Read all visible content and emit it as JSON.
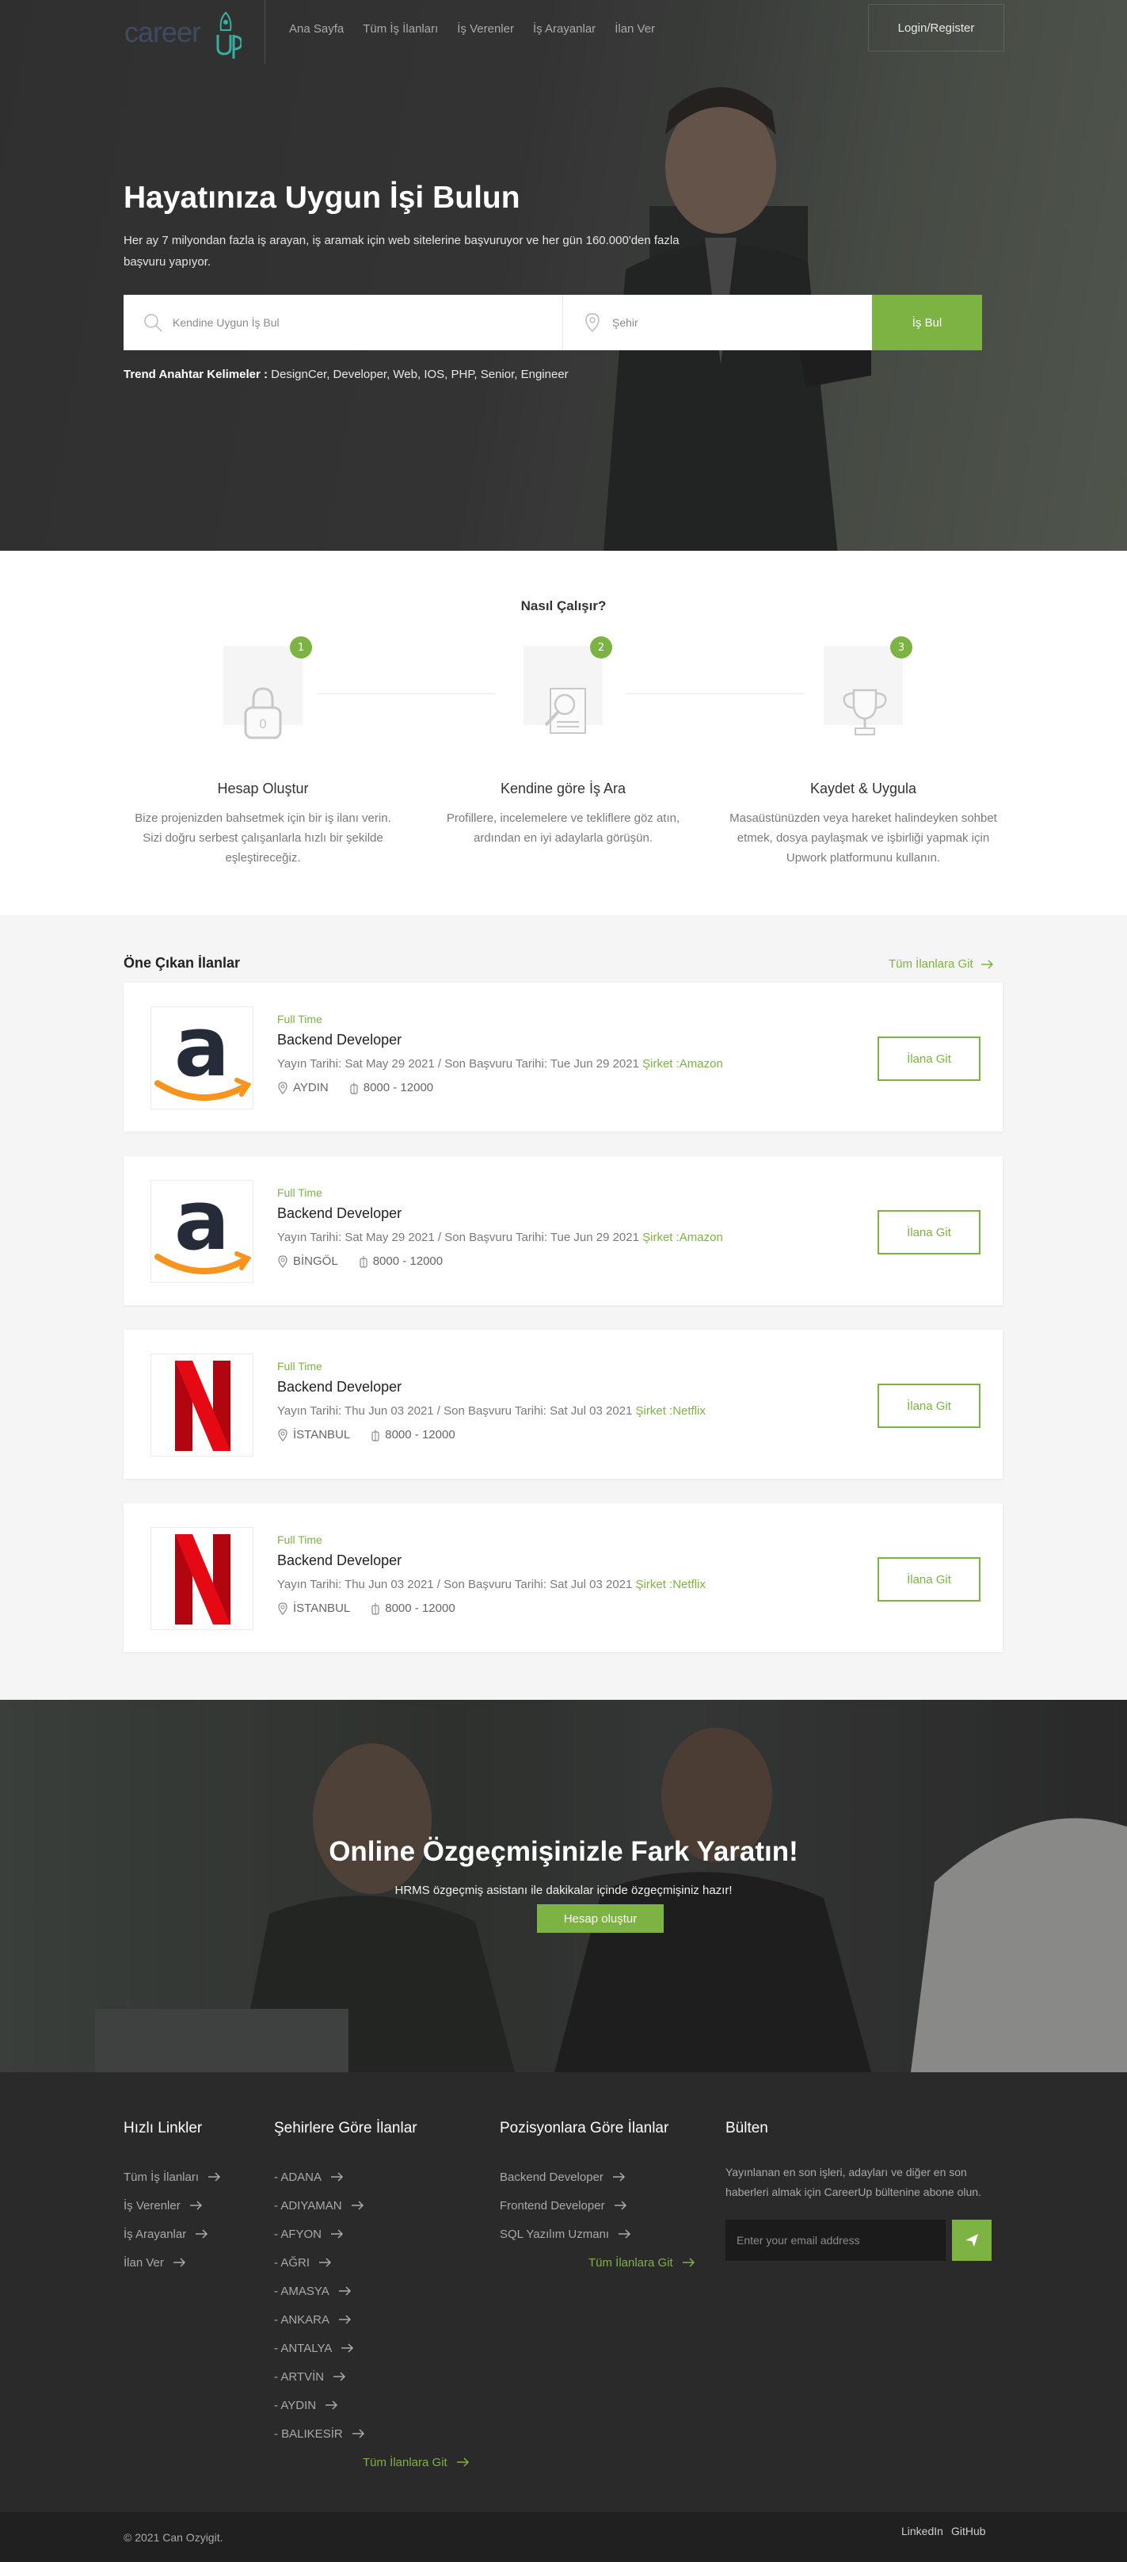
{
  "nav": {
    "logo_text": "career",
    "logo_up": "up",
    "menu": [
      "Ana Sayfa",
      "Tüm İş İlanları",
      "İş Verenler",
      "İş Arayanlar",
      "İlan Ver"
    ],
    "login": "Login/Register"
  },
  "hero": {
    "title": "Hayatınıza Uygun İşi Bulun",
    "subtitle": "Her ay 7 milyondan fazla iş arayan, iş aramak için web sitelerine başvuruyor ve her gün 160.000'den fazla başvuru yapıyor.",
    "keyword_placeholder": "Kendine Uygun İş Bul",
    "city_placeholder": "Şehir",
    "search_button": "İş Bul",
    "trend_label": "Trend Anahtar Kelimeler :",
    "trend_keywords": "DesignCer, Developer, Web, IOS, PHP, Senior, Engineer"
  },
  "how": {
    "title": "Nasıl Çalışır?",
    "steps": [
      {
        "num": "1",
        "title": "Hesap Oluştur",
        "text": "Bize projenizden bahsetmek için bir iş ilanı verin. Sizi doğru serbest çalışanlarla hızlı bir şekilde eşleştireceğiz.",
        "icon": "lock-icon"
      },
      {
        "num": "2",
        "title": "Kendine göre İş Ara",
        "text": "Profillere, incelemelere ve tekliflere göz atın, ardından en iyi adaylarla görüşün.",
        "icon": "search-document-icon"
      },
      {
        "num": "3",
        "title": "Kaydet & Uygula",
        "text": "Masaüstünüzden veya hareket halindeyken sohbet etmek, dosya paylaşmak ve işbirliği yapmak için Upwork platformunu kullanın.",
        "icon": "trophy-icon"
      }
    ]
  },
  "jobs": {
    "title": "Öne Çıkan İlanlar",
    "all_link": "Tüm İlanlara Git",
    "list": [
      {
        "type": "Full Time",
        "title": "Backend Developer",
        "dates": "Yayın Tarihi: Sat May 29 2021 / Son Başvuru Tarihi: Tue Jun 29 2021",
        "company": "Şirket :Amazon",
        "city": "AYDIN",
        "salary": "8000 - 12000",
        "logo": "amazon",
        "apply": "İlana Git"
      },
      {
        "type": "Full Time",
        "title": "Backend Developer",
        "dates": "Yayın Tarihi: Sat May 29 2021 / Son Başvuru Tarihi: Tue Jun 29 2021",
        "company": "Şirket :Amazon",
        "city": "BİNGÖL",
        "salary": "8000 - 12000",
        "logo": "amazon",
        "apply": "İlana Git"
      },
      {
        "type": "Full Time",
        "title": "Backend Developer",
        "dates": "Yayın Tarihi: Thu Jun 03 2021 / Son Başvuru Tarihi: Sat Jul 03 2021",
        "company": "Şirket :Netflix",
        "city": "İSTANBUL",
        "salary": "8000 - 12000",
        "logo": "netflix",
        "apply": "İlana Git"
      },
      {
        "type": "Full Time",
        "title": "Backend Developer",
        "dates": "Yayın Tarihi: Thu Jun 03 2021 / Son Başvuru Tarihi: Sat Jul 03 2021",
        "company": "Şirket :Netflix",
        "city": "İSTANBUL",
        "salary": "8000 - 12000",
        "logo": "netflix",
        "apply": "İlana Git"
      }
    ]
  },
  "cta": {
    "title": "Online Özgeçmişinizle Fark Yaratın!",
    "subtitle": "HRMS özgeçmiş asistanı ile dakikalar içinde özgeçmişiniz hazır!",
    "button": "Hesap oluştur"
  },
  "footer": {
    "quick": {
      "title": "Hızlı Linkler",
      "items": [
        "Tüm İş İlanları",
        "İş Verenler",
        "İş Arayanlar",
        "İlan Ver"
      ]
    },
    "cities": {
      "title": "Şehirlere Göre İlanlar",
      "items": [
        "- ADANA",
        "- ADIYAMAN",
        "- AFYON",
        "- AĞRI",
        "- AMASYA",
        "- ANKARA",
        "- ANTALYA",
        "- ARTVİN",
        "- AYDIN",
        "- BALIKESİR"
      ],
      "more": "Tüm İlanlara Git"
    },
    "positions": {
      "title": "Pozisyonlara Göre İlanlar",
      "items": [
        "Backend Developer",
        "Frontend Developer",
        "SQL Yazılım Uzmanı"
      ],
      "more": "Tüm İlanlara Git"
    },
    "newsletter": {
      "title": "Bülten",
      "text": "Yayınlanan en son işleri, adayları ve diğer en son haberleri almak için CareerUp bültenine abone olun.",
      "placeholder": "Enter your email address"
    },
    "copyright": "© 2021 Can Ozyigit.",
    "social": [
      "LinkedIn",
      "GitHub"
    ]
  },
  "colors": {
    "accent": "#7cb342",
    "footer_bg": "#2a2a2a",
    "amazon_orange": "#f90",
    "netflix_red": "#e50914"
  }
}
